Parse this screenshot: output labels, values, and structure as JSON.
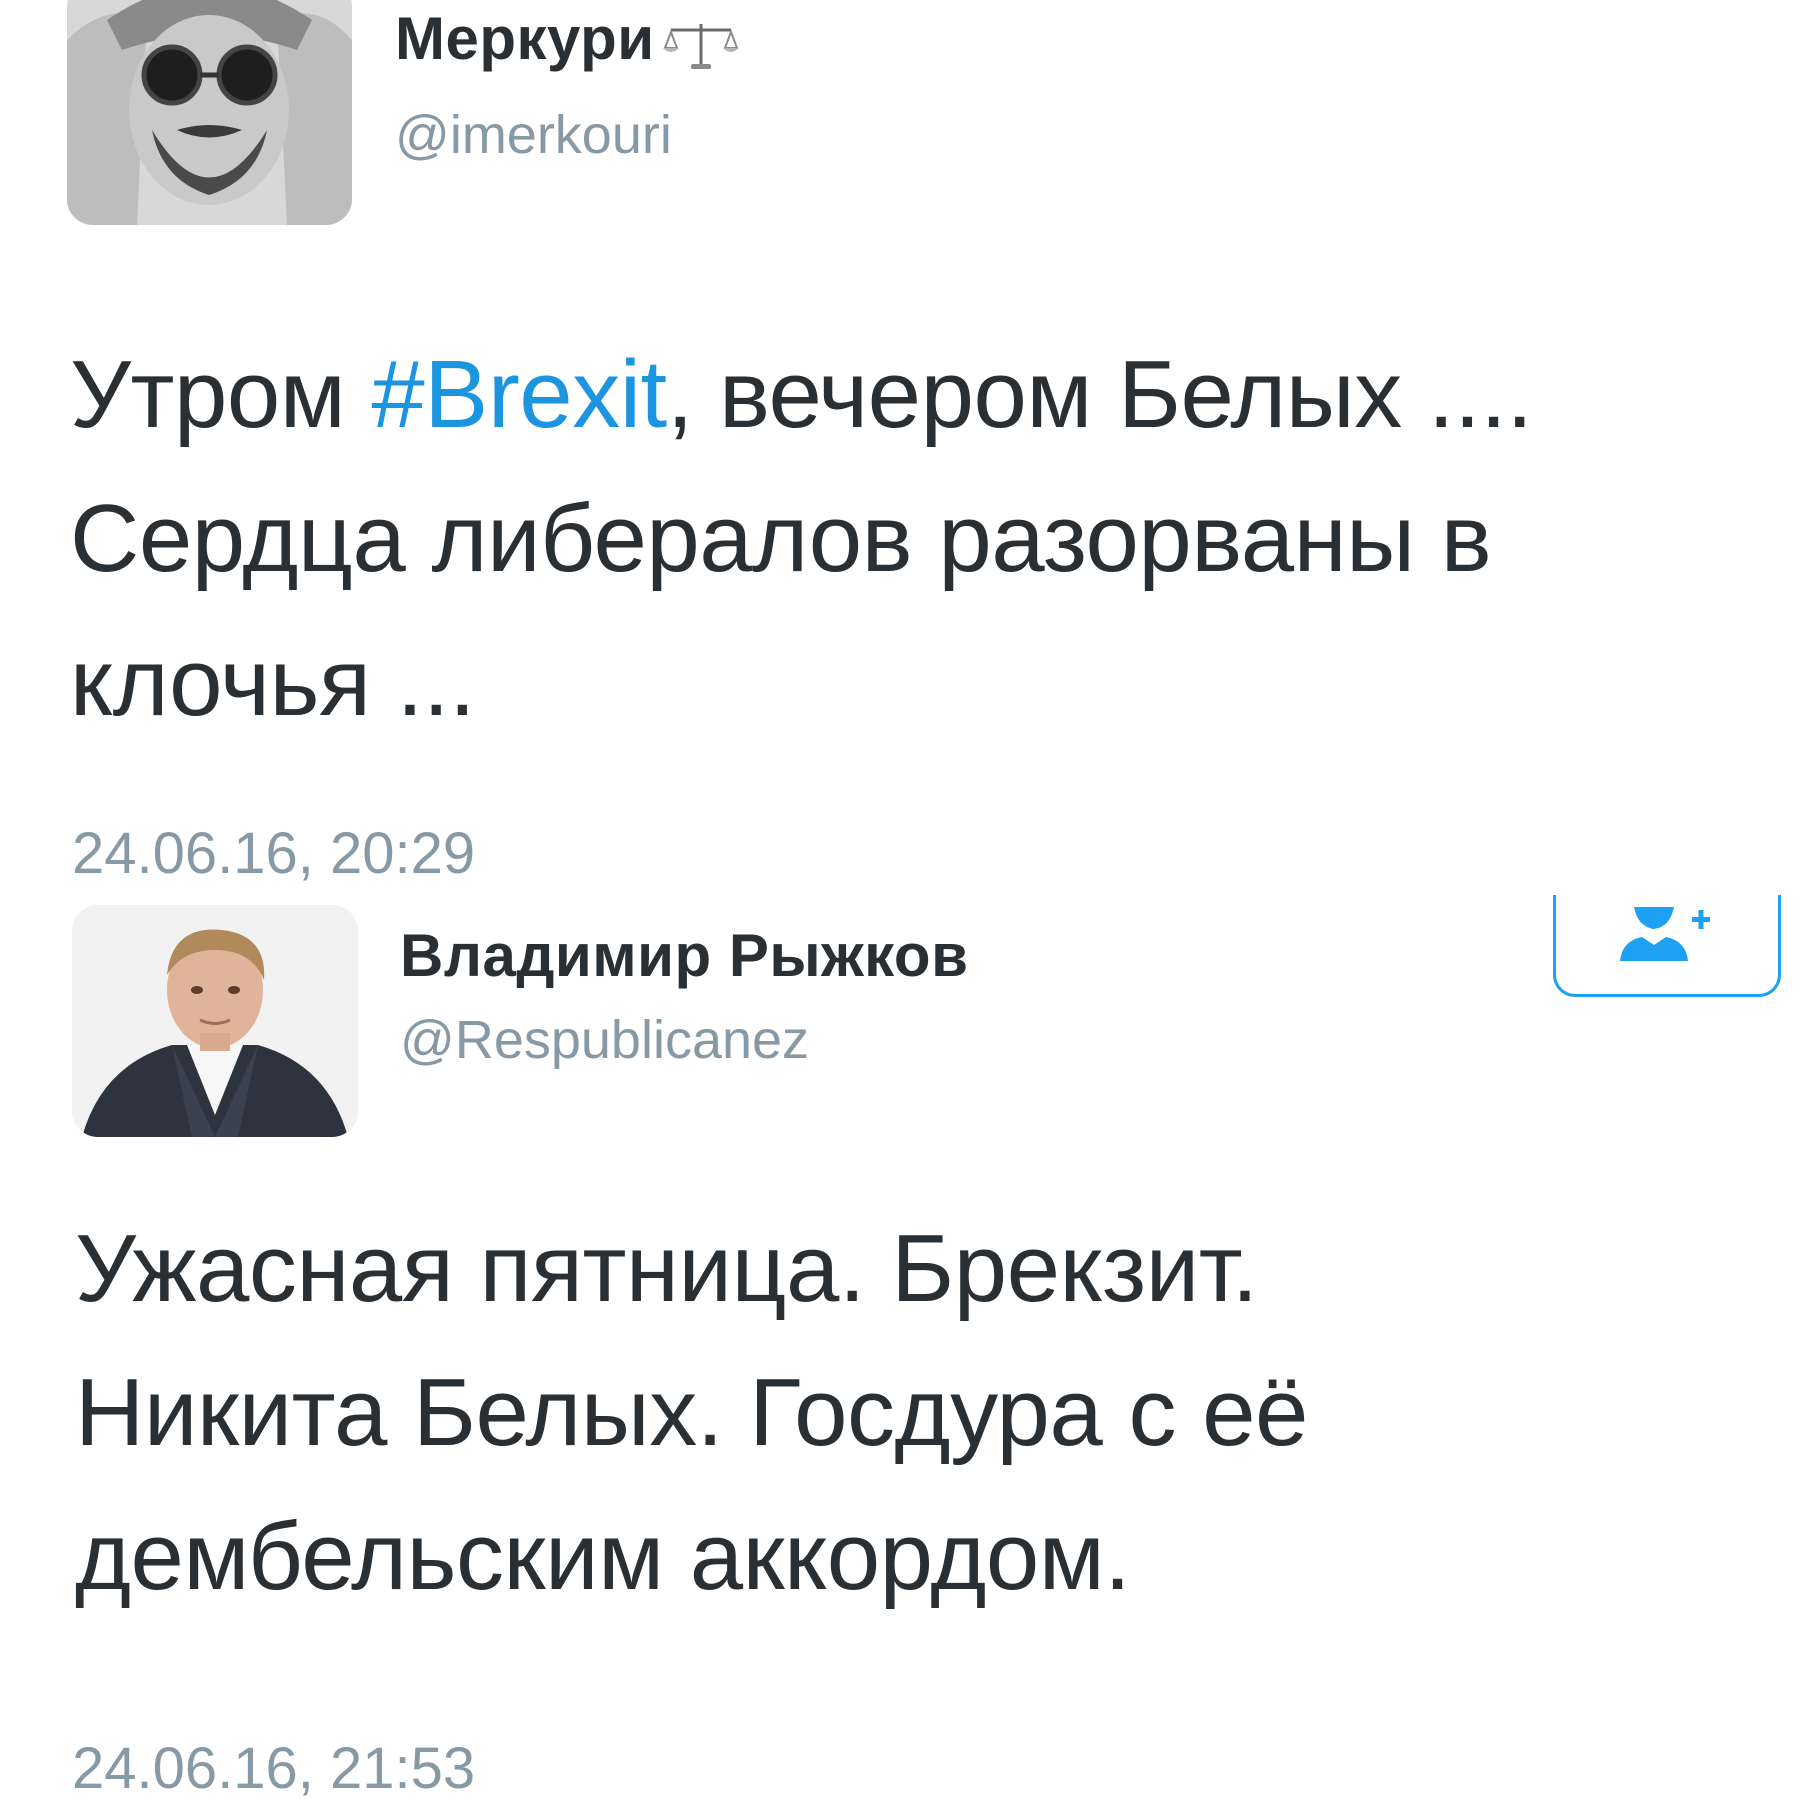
{
  "tweets": [
    {
      "author": {
        "display_name": "Меркури",
        "name_emoji": "balance-scale-emoji",
        "handle": "@imerkouri",
        "avatar": "avatar-photo-man-in-sunglasses-and-fur-hat"
      },
      "text": {
        "line1_before": "Утром ",
        "hashtag": "#Brexit",
        "line1_after": ", вечером Белых ....",
        "line2": "Сердца либералов разорваны в",
        "line3": "клочья ..."
      },
      "timestamp": "24.06.16, 20:29"
    },
    {
      "author": {
        "display_name": "Владимир Рыжков",
        "handle": "@Respublicanez",
        "avatar": "avatar-photo-man-in-suit"
      },
      "follow_button": {
        "icon": "follow-user-plus-icon"
      },
      "text": {
        "line1": "Ужасная пятница. Брекзит.",
        "line2": "Никита Белых. Госдура с её",
        "line3": "дембельским аккордом."
      },
      "timestamp": "24.06.16, 21:53"
    }
  ],
  "colors": {
    "text": "#292f33",
    "secondary": "#8899a6",
    "link": "#1b95e0",
    "accent": "#1da1f2",
    "background": "#ffffff"
  }
}
